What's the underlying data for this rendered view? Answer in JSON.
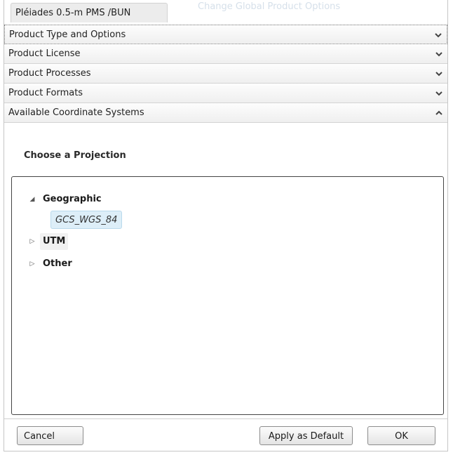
{
  "window": {
    "title": "Pléiades 0.5-m PMS /BUN",
    "ghost_title": "Change Global Product Options"
  },
  "sections": [
    {
      "label": "Product Type and Options",
      "icon": "chevron-down-icon",
      "expanded": false
    },
    {
      "label": "Product License",
      "icon": "chevron-down-icon",
      "expanded": false
    },
    {
      "label": "Product Processes",
      "icon": "chevron-down-icon",
      "expanded": false
    },
    {
      "label": "Product Formats",
      "icon": "chevron-down-icon",
      "expanded": false
    },
    {
      "label": "Available Coordinate Systems",
      "icon": "chevron-up-icon",
      "expanded": true
    }
  ],
  "projection": {
    "heading": "Choose a Projection",
    "tree": {
      "geographic": {
        "label": "Geographic",
        "expanded": true,
        "children": [
          "GCS_WGS_84"
        ]
      },
      "utm": {
        "label": "UTM",
        "expanded": false
      },
      "other": {
        "label": "Other",
        "expanded": false
      }
    }
  },
  "buttons": {
    "cancel": "Cancel",
    "apply_default": "Apply as Default",
    "ok": "OK"
  },
  "colors": {
    "selected_node_bg": "#ddeef8",
    "section_bg": "#efefef",
    "tree_border": "#444444"
  }
}
